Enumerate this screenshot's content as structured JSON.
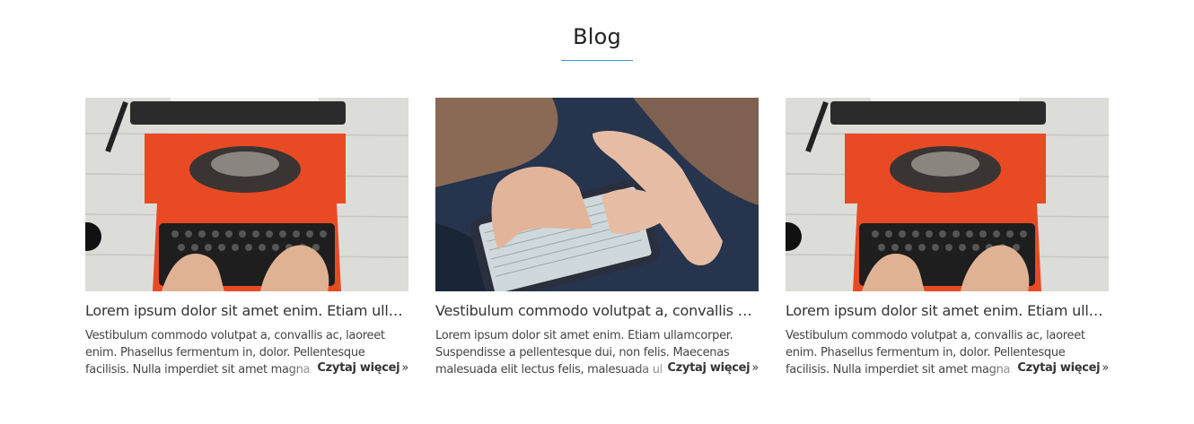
{
  "section": {
    "title": "Blog",
    "accent_color": "#3a9ad9"
  },
  "posts": [
    {
      "image": "typewriter-photo",
      "title": "Lorem ipsum dolor sit amet enim. Etiam ullamcorper.",
      "excerpt": "Vestibulum commodo volutpat a, convallis ac, laoreet enim. Phasellus fermentum in, dolor. Pellentesque facilisis. Nulla imperdiet sit amet magna.",
      "read_more": "Czytaj więcej",
      "read_more_icon": "double-chevron-right-icon"
    },
    {
      "image": "smartphone-photo",
      "title": "Vestibulum commodo volutpat a, convallis ac, laoreet enim.",
      "excerpt": "Lorem ipsum dolor sit amet enim. Etiam ullamcorper. Suspendisse a pellentesque dui, non felis. Maecenas malesuada elit lectus felis, malesuada ultricies.",
      "read_more": "Czytaj więcej",
      "read_more_icon": "double-chevron-right-icon"
    },
    {
      "image": "typewriter-photo",
      "title": "Lorem ipsum dolor sit amet enim. Etiam ullamcorper.",
      "excerpt": "Vestibulum commodo volutpat a, convallis ac, laoreet enim. Phasellus fermentum in, dolor. Pellentesque facilisis. Nulla imperdiet sit amet magna.",
      "read_more": "Czytaj więcej",
      "read_more_icon": "double-chevron-right-icon"
    }
  ]
}
